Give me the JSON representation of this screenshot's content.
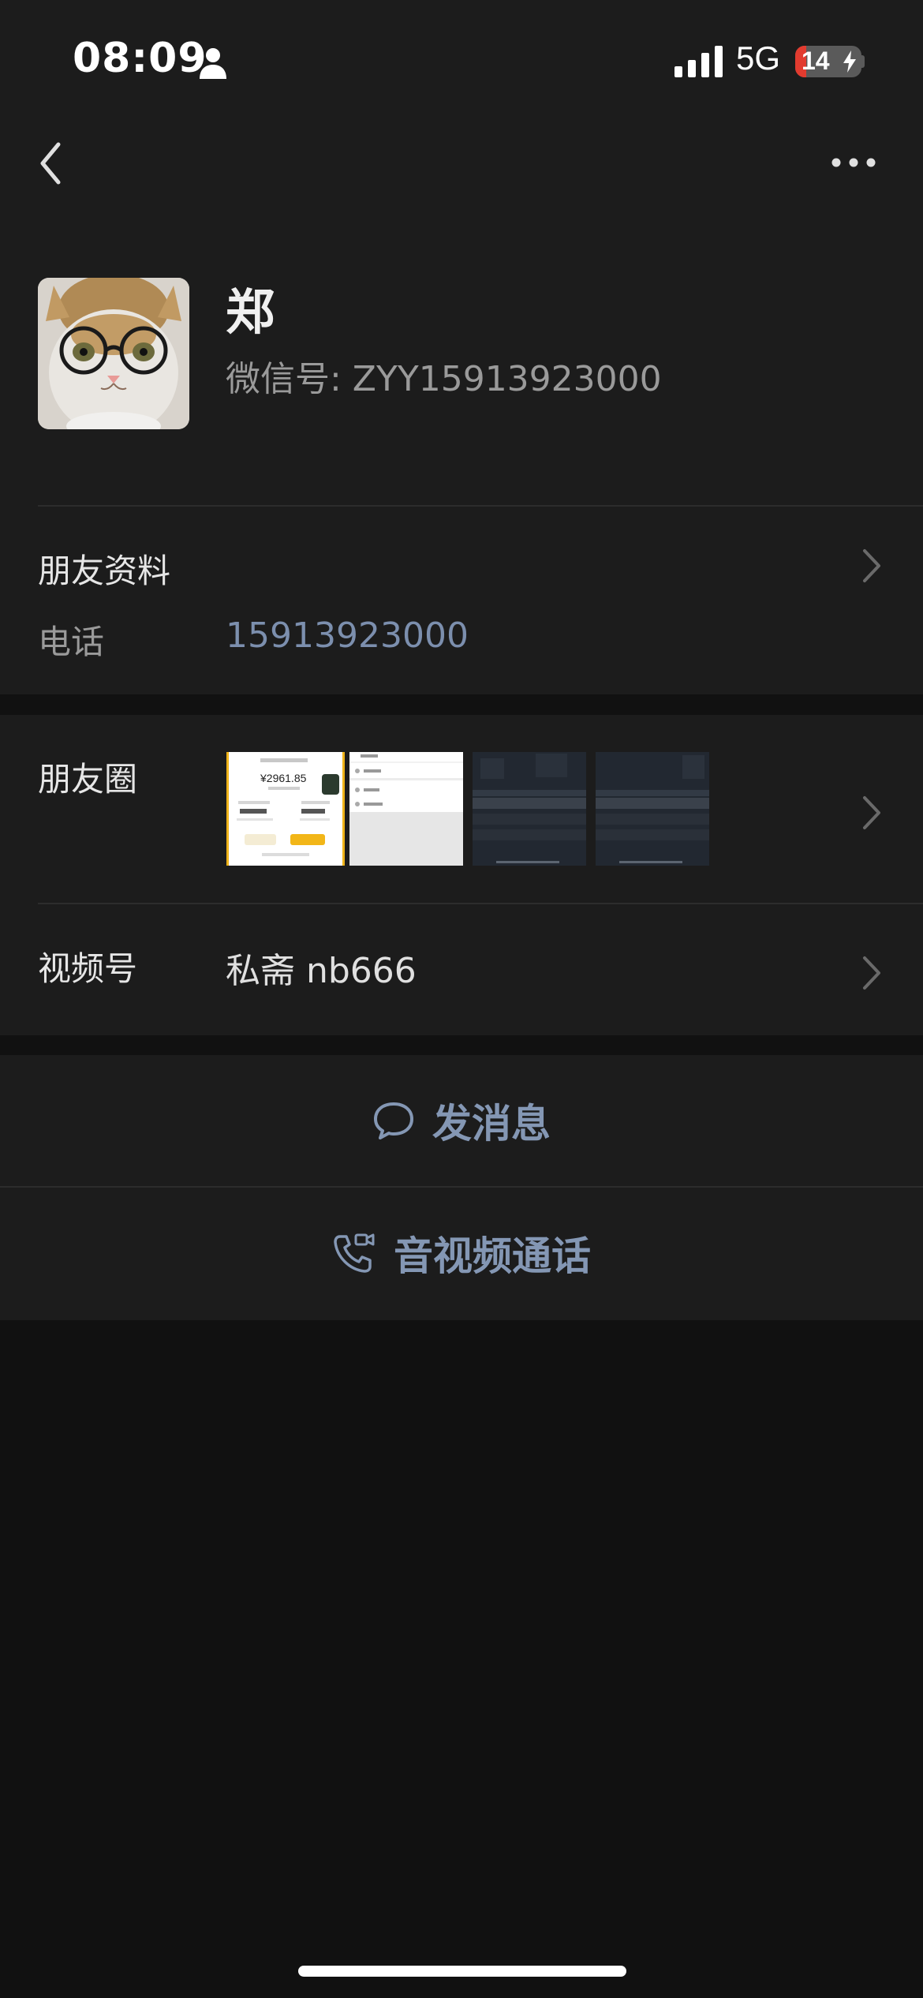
{
  "status_bar": {
    "time": "08:09",
    "network": "5G",
    "battery": "14"
  },
  "profile": {
    "name": "郑",
    "wechat_id": "微信号: ZYY15913923000"
  },
  "friend_info": {
    "title": "朋友资料",
    "phone_label": "电话",
    "phone_value": "15913923000"
  },
  "moments": {
    "label": "朋友圈",
    "thumb1_amount": "¥2961.85"
  },
  "channels": {
    "label": "视频号",
    "value": "私斋 nb666"
  },
  "actions": {
    "message": "发消息",
    "call": "音视频通话"
  },
  "colors": {
    "background": "#111111",
    "card": "#1c1c1c",
    "link": "#7c8fae",
    "action": "#8497b4"
  },
  "icons": [
    "person-icon",
    "signal-icon",
    "battery-icon",
    "back-icon",
    "more-icon",
    "chevron-right-icon",
    "message-icon",
    "video-call-icon"
  ]
}
